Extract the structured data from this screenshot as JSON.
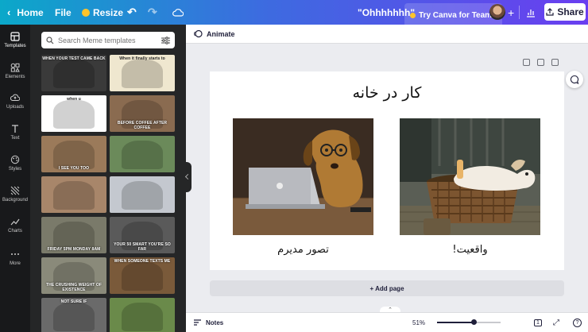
{
  "topbar": {
    "home_label": "Home",
    "file_label": "File",
    "resize_label": "Resize",
    "doc_title": "\"Ohhhhhhh\"",
    "try_teams_label": "Try Canva for Teams",
    "share_label": "Share"
  },
  "rail": {
    "items": [
      {
        "label": "Templates",
        "icon": "templates-icon"
      },
      {
        "label": "Elements",
        "icon": "elements-icon"
      },
      {
        "label": "Uploads",
        "icon": "uploads-icon"
      },
      {
        "label": "Text",
        "icon": "text-icon"
      },
      {
        "label": "Styles",
        "icon": "styles-icon"
      },
      {
        "label": "Background",
        "icon": "background-icon"
      },
      {
        "label": "Charts",
        "icon": "charts-icon"
      },
      {
        "label": "More",
        "icon": "more-icon"
      }
    ]
  },
  "panel": {
    "search_placeholder": "Search Meme templates",
    "thumbs": [
      {
        "caption_top": "WHEN YOUR TEST CAME BACK",
        "caption_bottom": "",
        "bg": "#3a3a3a"
      },
      {
        "caption_top": "When it finally starts to",
        "caption_bottom": "",
        "bg": "#efe7cf"
      },
      {
        "caption_top": "when u",
        "caption_bottom": "",
        "bg": "#ffffff"
      },
      {
        "caption_top": "",
        "caption_bottom": "BEFORE COFFEE   AFTER COFFEE",
        "bg": "#8a6b50"
      },
      {
        "caption_top": "",
        "caption_bottom": "I SEE YOU TOO",
        "bg": "#9b7a5a"
      },
      {
        "caption_top": "",
        "caption_bottom": "",
        "bg": "#6b8a5a"
      },
      {
        "caption_top": "",
        "caption_bottom": "",
        "bg": "#a8866a"
      },
      {
        "caption_top": "",
        "caption_bottom": "",
        "bg": "#c4c8cf"
      },
      {
        "caption_top": "",
        "caption_bottom": "FRIDAY 5PM   MONDAY 8AM",
        "bg": "#7a7a6a"
      },
      {
        "caption_top": "",
        "caption_bottom": "YOUR 50 SMART   YOU'RE SO FAR",
        "bg": "#5a5a5a"
      },
      {
        "caption_top": "",
        "caption_bottom": "THE CRUSHING WEIGHT OF EXISTENCE",
        "bg": "#8a8a7a"
      },
      {
        "caption_top": "WHEN SOMEONE TEXTS ME",
        "caption_bottom": "",
        "bg": "#7a5a3a"
      },
      {
        "caption_top": "NOT SURE IF",
        "caption_bottom": "",
        "bg": "#6a6a6a"
      },
      {
        "caption_top": "",
        "caption_bottom": "",
        "bg": "#6a8a4a"
      }
    ]
  },
  "editor": {
    "animate_label": "Animate",
    "page_title": "کار در خانه",
    "left_caption": "تصور مدیرم",
    "right_caption": "واقعیت!",
    "add_page_label": "+ Add page"
  },
  "bottombar": {
    "notes_label": "Notes",
    "zoom": "51%",
    "zoom_fraction": 0.58,
    "page_number": "1"
  },
  "colors": {
    "accent": "#7d2ae8",
    "rail_bg": "#18191b",
    "panel_bg": "#252627"
  }
}
